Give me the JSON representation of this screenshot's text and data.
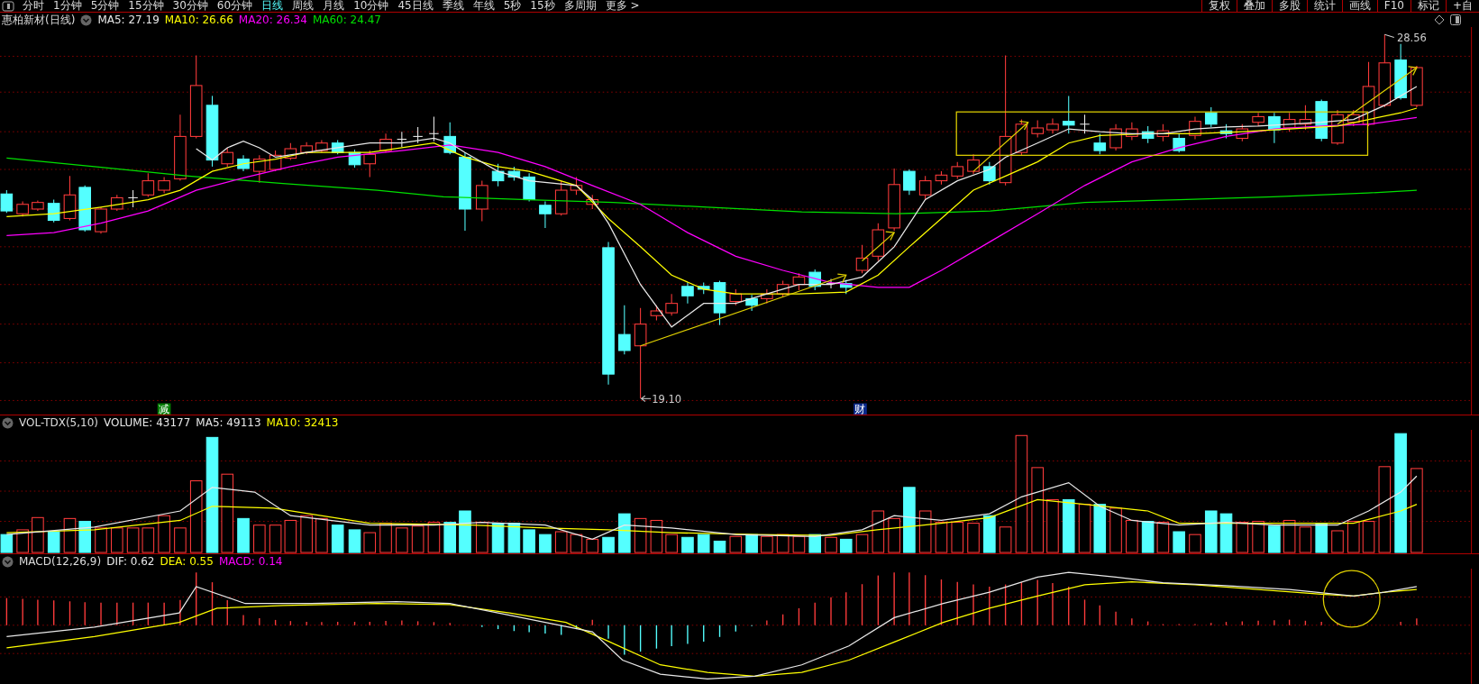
{
  "toolbar": {
    "periods": [
      {
        "label": "分时",
        "selected": false
      },
      {
        "label": "1分钟",
        "selected": false
      },
      {
        "label": "5分钟",
        "selected": false
      },
      {
        "label": "15分钟",
        "selected": false
      },
      {
        "label": "30分钟",
        "selected": false
      },
      {
        "label": "60分钟",
        "selected": false
      },
      {
        "label": "日线",
        "selected": true
      },
      {
        "label": "周线",
        "selected": false
      },
      {
        "label": "月线",
        "selected": false
      },
      {
        "label": "10分钟",
        "selected": false
      },
      {
        "label": "45日线",
        "selected": false
      },
      {
        "label": "季线",
        "selected": false
      },
      {
        "label": "年线",
        "selected": false
      },
      {
        "label": "5秒",
        "selected": false
      },
      {
        "label": "15秒",
        "selected": false
      },
      {
        "label": "多周期",
        "selected": false
      },
      {
        "label": "更多 >",
        "selected": false
      }
    ],
    "tools": [
      "复权",
      "叠加",
      "多股",
      "统计",
      "画线",
      "F10",
      "标记",
      "+自"
    ]
  },
  "main_chart": {
    "title": "惠柏新材(日线)",
    "indicators": [
      {
        "label": "MA5: 27.19",
        "color": "#e8e8e8"
      },
      {
        "label": "MA10: 26.66",
        "color": "#ffff00"
      },
      {
        "label": "MA20: 26.34",
        "color": "#ff00ff"
      },
      {
        "label": "MA60: 24.47",
        "color": "#00e000"
      }
    ],
    "high_label": "28.56",
    "low_label": "19.10",
    "markers": [
      {
        "text": "减",
        "color": "#007a00"
      },
      {
        "text": "财",
        "color": "#0a2a8a"
      }
    ]
  },
  "volume_chart": {
    "title": "VOL-TDX(5,10)",
    "indicators": [
      {
        "label": "VOLUME: 43177",
        "color": "#e8e8e8"
      },
      {
        "label": "MA5: 49113",
        "color": "#e8e8e8"
      },
      {
        "label": "MA10: 32413",
        "color": "#ffff00"
      }
    ]
  },
  "macd_chart": {
    "title": "MACD(12,26,9)",
    "indicators": [
      {
        "label": "DIF: 0.62",
        "color": "#e8e8e8"
      },
      {
        "label": "DEA: 0.55",
        "color": "#ffff00"
      },
      {
        "label": "MACD: 0.14",
        "color": "#ff00ff"
      }
    ]
  }
}
